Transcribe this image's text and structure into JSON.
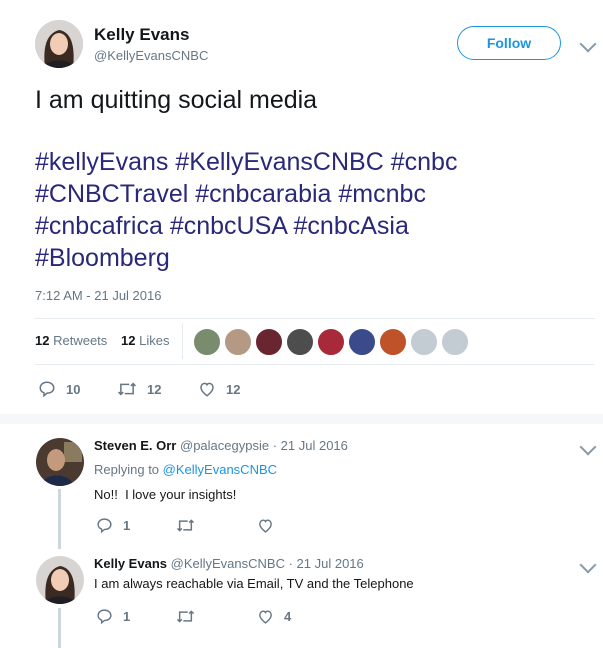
{
  "main_tweet": {
    "author_name": "Kelly Evans",
    "author_handle": "@KellyEvansCNBC",
    "follow_label": "Follow",
    "text_line1": "I am quitting social media",
    "hashtags_line1": [
      "#kellyEvans",
      "#KellyEvansCNBC",
      "#cnbc"
    ],
    "hashtags_line2": [
      "#CNBCTravel",
      "#cnbcarabia",
      "#mcnbc"
    ],
    "hashtags_line3": [
      "#cnbcafrica",
      "#cnbcUSA",
      "#cnbcAsia"
    ],
    "hashtags_line4": [
      "#Bloomberg"
    ],
    "timestamp": "7:12 AM - 21 Jul 2016",
    "retweets_count": "12",
    "retweets_label": "Retweets",
    "likes_count": "12",
    "likes_label": "Likes",
    "reply_count": "10",
    "retweet_action_count": "12",
    "like_action_count": "12"
  },
  "replies": [
    {
      "author_name": "Steven E. Orr",
      "author_handle": "@palacegypsie",
      "date": "· 21 Jul 2016",
      "replying_to_label": "Replying to",
      "replying_to_handle": "@KellyEvansCNBC",
      "text": "No!!  I love your insights!",
      "reply_count": "1",
      "retweet_count": "",
      "like_count": ""
    },
    {
      "author_name": "Kelly Evans",
      "author_handle": "@KellyEvansCNBC",
      "date": "· 21 Jul 2016",
      "text": "I am always reachable via Email, TV and the Telephone",
      "reply_count": "1",
      "retweet_count": "",
      "like_count": "4"
    }
  ],
  "colors": {
    "link": "#1b95e0",
    "hashtag": "#2a2878",
    "secondary_text": "#657786",
    "divider": "#e6ecf0"
  },
  "icons": [
    "reply-icon",
    "retweet-icon",
    "heart-icon",
    "chevron-down-icon"
  ]
}
